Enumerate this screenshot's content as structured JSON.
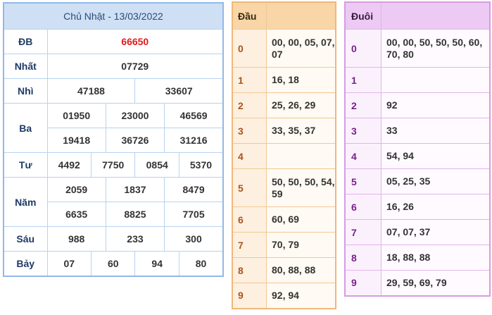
{
  "results": {
    "date_title": "Chủ Nhật - 13/03/2022",
    "prizes": [
      {
        "label": "ĐB",
        "values": [
          "66650"
        ]
      },
      {
        "label": "Nhất",
        "values": [
          "07729"
        ]
      },
      {
        "label": "Nhì",
        "values": [
          "47188",
          "33607"
        ]
      },
      {
        "label": "Ba",
        "values": [
          "01950",
          "23000",
          "46569",
          "19418",
          "36726",
          "31216"
        ]
      },
      {
        "label": "Tư",
        "values": [
          "4492",
          "7750",
          "0854",
          "5370"
        ]
      },
      {
        "label": "Năm",
        "values": [
          "2059",
          "1837",
          "8479",
          "6635",
          "8825",
          "7705"
        ]
      },
      {
        "label": "Sáu",
        "values": [
          "988",
          "233",
          "300"
        ]
      },
      {
        "label": "Bảy",
        "values": [
          "07",
          "60",
          "94",
          "80"
        ]
      }
    ]
  },
  "dau": {
    "title": "Đầu",
    "rows": [
      {
        "key": "0",
        "value": "00, 00, 05, 07, 07"
      },
      {
        "key": "1",
        "value": "16, 18"
      },
      {
        "key": "2",
        "value": "25, 26, 29"
      },
      {
        "key": "3",
        "value": "33, 35, 37"
      },
      {
        "key": "4",
        "value": ""
      },
      {
        "key": "5",
        "value": "50, 50, 50, 54, 59"
      },
      {
        "key": "6",
        "value": "60, 69"
      },
      {
        "key": "7",
        "value": "70, 79"
      },
      {
        "key": "8",
        "value": "80, 88, 88"
      },
      {
        "key": "9",
        "value": "92, 94"
      }
    ]
  },
  "duoi": {
    "title": "Đuôi",
    "rows": [
      {
        "key": "0",
        "value": "00, 00, 50, 50, 50, 60, 70, 80"
      },
      {
        "key": "1",
        "value": ""
      },
      {
        "key": "2",
        "value": "92"
      },
      {
        "key": "3",
        "value": "33"
      },
      {
        "key": "4",
        "value": "54, 94"
      },
      {
        "key": "5",
        "value": "05, 25, 35"
      },
      {
        "key": "6",
        "value": "16, 26"
      },
      {
        "key": "7",
        "value": "07, 07, 37"
      },
      {
        "key": "8",
        "value": "18, 88, 88"
      },
      {
        "key": "9",
        "value": "29, 59, 69, 79"
      }
    ]
  }
}
